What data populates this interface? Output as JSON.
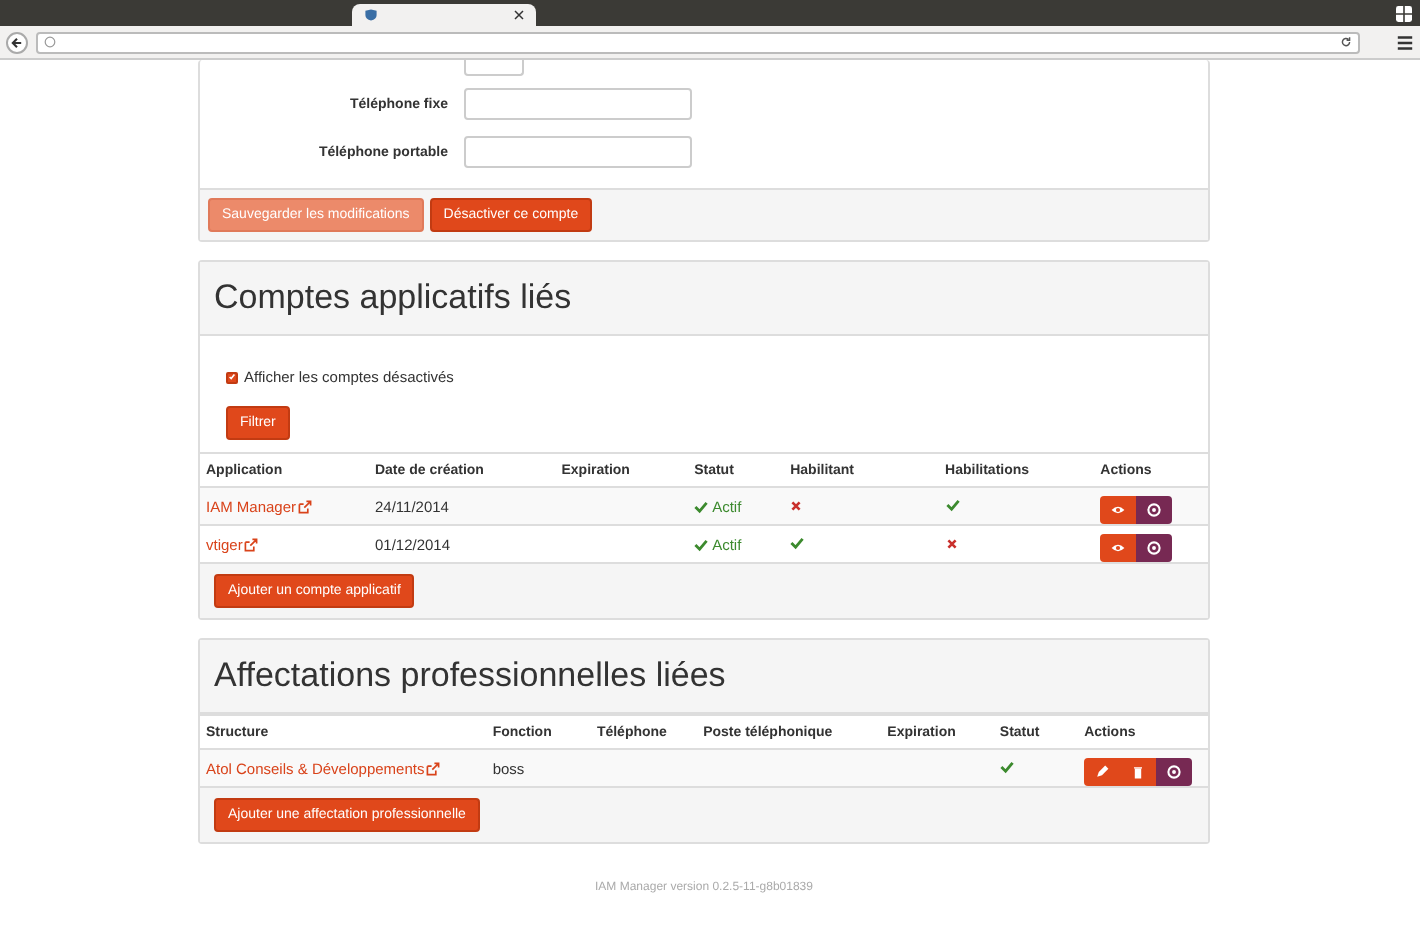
{
  "form": {
    "fields": [
      {
        "label": "Téléphone fixe"
      },
      {
        "label": "Téléphone portable"
      }
    ],
    "buttons": [
      {
        "label": "Sauvegarder les modifications",
        "disabled": true
      },
      {
        "label": "Désactiver ce compte",
        "disabled": false
      }
    ]
  },
  "accounts": {
    "title": "Comptes applicatifs liés",
    "filter_checkbox": {
      "label": "Afficher les comptes désactivés",
      "checked": true
    },
    "filter_button": "Filtrer",
    "columns": [
      "Application",
      "Date de création",
      "Expiration",
      "Statut",
      "Habilitant",
      "Habilitations",
      "Actions"
    ],
    "rows": [
      {
        "application": "IAM Manager",
        "created": "24/11/2014",
        "status": {
          "active": true,
          "text": "Actif"
        },
        "habilitant": false,
        "habilitations": true,
        "actions": [
          {
            "kind": "view"
          },
          {
            "kind": "disable"
          }
        ]
      },
      {
        "application": "vtiger",
        "created": "01/12/2014",
        "status": {
          "active": true,
          "text": "Actif"
        },
        "habilitant": true,
        "habilitations": false,
        "actions": [
          {
            "kind": "view"
          },
          {
            "kind": "disable"
          }
        ]
      }
    ],
    "add_button": "Ajouter un compte applicatif"
  },
  "assignments": {
    "title": "Affectations professionnelles liées",
    "columns": [
      "Structure",
      "Fonction",
      "Téléphone",
      "Poste téléphonique",
      "Expiration",
      "Statut",
      "Actions"
    ],
    "rows": [
      {
        "structure": "Atol Conseils & Développements",
        "function": "boss",
        "status_ok": true,
        "actions": [
          {
            "kind": "edit"
          },
          {
            "kind": "delete"
          },
          {
            "kind": "disable"
          }
        ]
      }
    ],
    "add_button": "Ajouter une affectation professionnelle"
  },
  "footer": "IAM Manager version 0.2.5-11-g8b01839"
}
